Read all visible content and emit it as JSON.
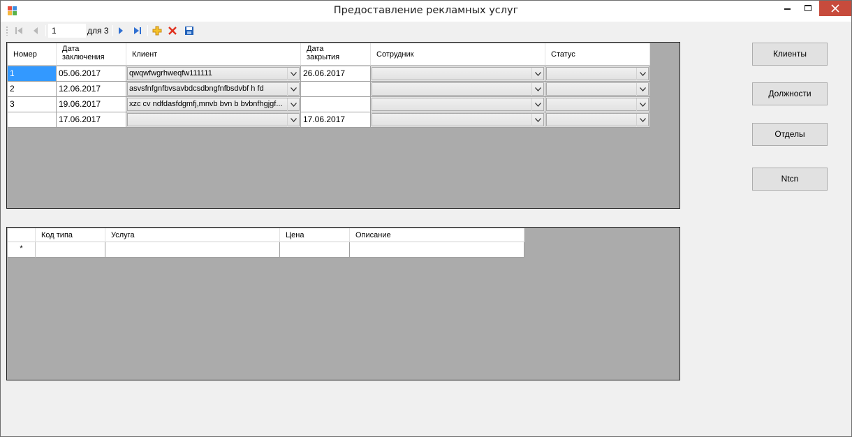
{
  "window": {
    "title": "Предоставление рекламных услуг"
  },
  "navigator": {
    "position": "1",
    "count_label": "для 3"
  },
  "contracts": {
    "columns": [
      "Номер",
      "Дата\nзаключения",
      "Клиент",
      "Дата\nзакрытия",
      "Сотрудник",
      "Статус"
    ],
    "rows": [
      {
        "number": "1",
        "date_start": "05.06.2017",
        "client": "qwqwfwgrhweqfw111111",
        "date_end": "26.06.2017",
        "employee": "",
        "status": ""
      },
      {
        "number": "2",
        "date_start": "12.06.2017",
        "client": "asvsfnfgnfbvsavbdcsdbngfnfbsdvbf h fd",
        "date_end": "",
        "employee": "",
        "status": ""
      },
      {
        "number": "3",
        "date_start": "19.06.2017",
        "client": " xzc cv ndfdasfdgmfj,mnvb bvn b bvbnfhgjgf...",
        "date_end": "",
        "employee": "",
        "status": ""
      },
      {
        "number": "",
        "date_start": "17.06.2017",
        "client": "",
        "date_end": "17.06.2017",
        "employee": "",
        "status": ""
      }
    ]
  },
  "services": {
    "columns": [
      "Код типа",
      "Услуга",
      "Цена",
      "Описание"
    ],
    "new_row_marker": "*"
  },
  "buttons": {
    "clients": "Клиенты",
    "positions": "Должности",
    "departments": "Отделы",
    "ntcn": "Ntcn"
  }
}
